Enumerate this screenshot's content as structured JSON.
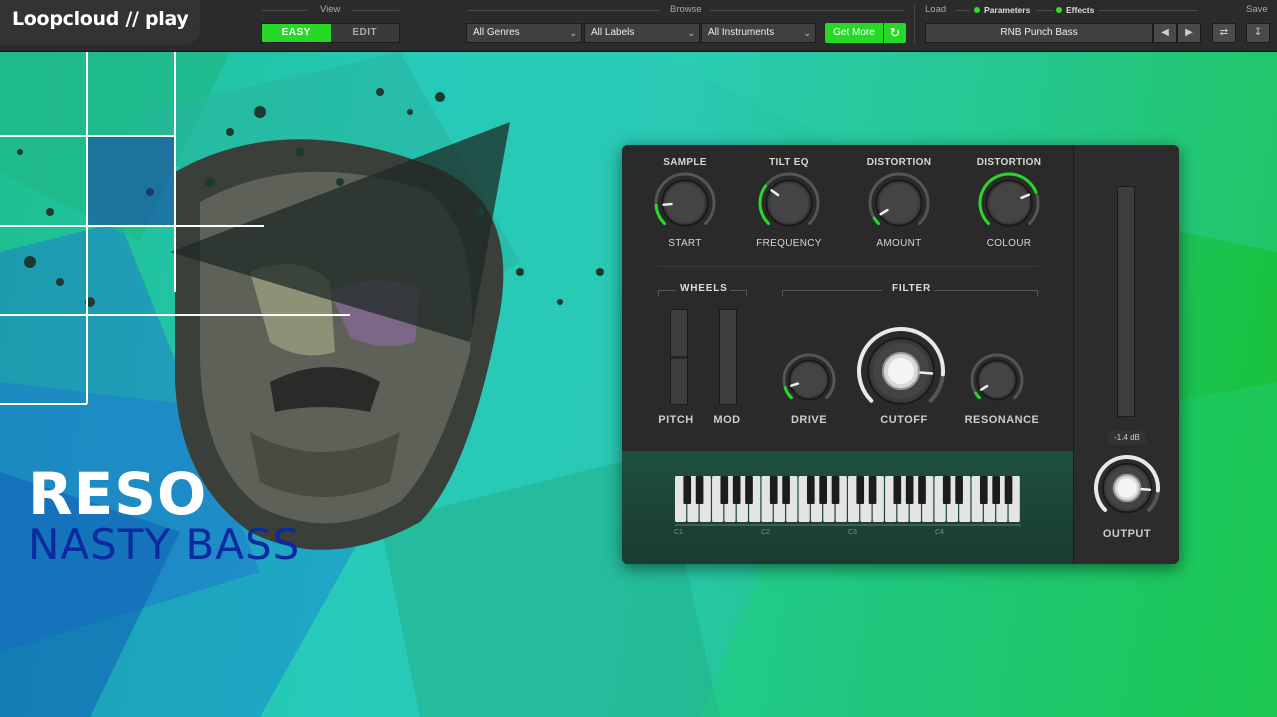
{
  "app": {
    "logo": "Loopcloud // play"
  },
  "view": {
    "label": "View",
    "easy": "EASY",
    "edit": "EDIT"
  },
  "browse": {
    "label": "Browse",
    "genres": "All Genres",
    "labels": "All Labels",
    "instruments": "All Instruments",
    "get_more": "Get More"
  },
  "load": {
    "label": "Load",
    "parameters": "Parameters",
    "effects": "Effects",
    "preset": "RNB Punch Bass"
  },
  "save": {
    "label": "Save"
  },
  "artwork": {
    "title": "RESO",
    "subtitle": "NASTY BASS"
  },
  "panel": {
    "knobs": [
      {
        "top": "SAMPLE",
        "bottom": "START",
        "value": 0.15
      },
      {
        "top": "TILT EQ",
        "bottom": "FREQUENCY",
        "value": 0.3
      },
      {
        "top": "DISTORTION",
        "bottom": "AMOUNT",
        "value": 0.05
      },
      {
        "top": "DISTORTION",
        "bottom": "COLOUR",
        "value": 0.75
      }
    ],
    "wheels_label": "WHEELS",
    "filter_label": "FILTER",
    "pitch": "PITCH",
    "mod": "MOD",
    "drive": {
      "label": "DRIVE",
      "value": 0.1
    },
    "cutoff": {
      "label": "CUTOFF",
      "value": 0.85
    },
    "resonance": {
      "label": "RESONANCE",
      "value": 0.05
    },
    "octaves": [
      "C1",
      "C2",
      "C3",
      "C4"
    ],
    "output_db": "-1.4 dB",
    "output_label": "OUTPUT",
    "output_value": 0.85
  },
  "colors": {
    "accent": "#27d827",
    "panel": "#2a2a2a"
  }
}
